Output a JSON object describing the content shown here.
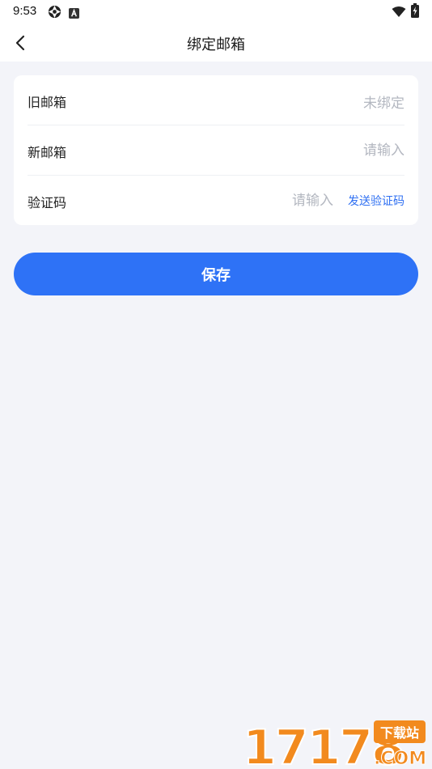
{
  "status_bar": {
    "time": "9:53",
    "icons": [
      "aperture-icon",
      "text-a-icon",
      "wifi-icon",
      "battery-charging-icon"
    ]
  },
  "nav": {
    "title": "绑定邮箱",
    "back_icon": "chevron-left-icon"
  },
  "form": {
    "old_email": {
      "label": "旧邮箱",
      "value": "未绑定"
    },
    "new_email": {
      "label": "新邮箱",
      "placeholder": "请输入"
    },
    "code": {
      "label": "验证码",
      "placeholder": "请输入",
      "send_label": "发送验证码"
    }
  },
  "save_label": "保存",
  "watermark": {
    "number": "17178",
    "site": "下载站",
    "suffix": ".COM"
  },
  "colors": {
    "background": "#f3f4f9",
    "card": "#ffffff",
    "primary": "#2e72f6",
    "link": "#2e6ff2",
    "placeholder": "#b3b7c0",
    "watermark_orange": "#f28a1e"
  }
}
